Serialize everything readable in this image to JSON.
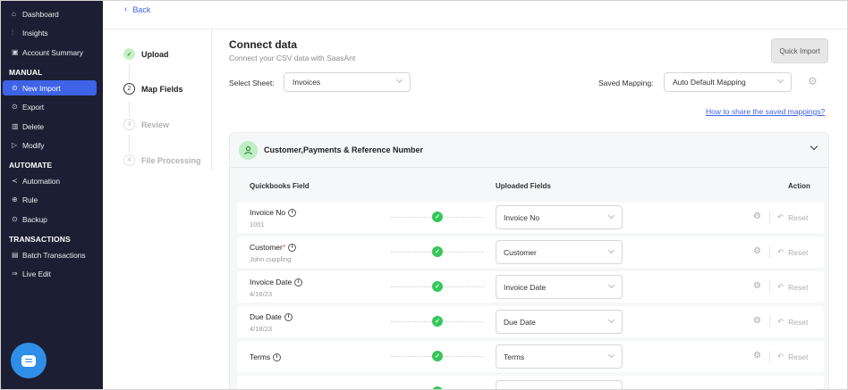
{
  "sidebar": {
    "items": [
      {
        "label": "Dashboard",
        "icon": "home-icon",
        "glyph": "⌂"
      },
      {
        "label": "Insights",
        "icon": "insights-icon",
        "glyph": "⫶"
      },
      {
        "label": "Account Summary",
        "icon": "account-summary-icon",
        "glyph": "▣"
      }
    ],
    "manual_title": "MANUAL",
    "manual_items": [
      {
        "label": "New Import",
        "icon": "import-icon",
        "glyph": "⊙",
        "active": true
      },
      {
        "label": "Export",
        "icon": "export-icon",
        "glyph": "⊙"
      },
      {
        "label": "Delete",
        "icon": "delete-icon",
        "glyph": "▥"
      },
      {
        "label": "Modify",
        "icon": "modify-icon",
        "glyph": "▷"
      }
    ],
    "automate_title": "AUTOMATE",
    "automate_items": [
      {
        "label": "Automation",
        "icon": "automation-icon",
        "glyph": "≺"
      },
      {
        "label": "Rule",
        "icon": "rule-icon",
        "glyph": "⊕"
      },
      {
        "label": "Backup",
        "icon": "backup-icon",
        "glyph": "⊙"
      }
    ],
    "transactions_title": "TRANSACTIONS",
    "transactions_items": [
      {
        "label": "Batch Transactions",
        "icon": "batch-icon",
        "glyph": "▤"
      },
      {
        "label": "Live Edit",
        "icon": "live-edit-icon",
        "glyph": "⇒"
      }
    ]
  },
  "back": {
    "label": "Back"
  },
  "steps": [
    {
      "num": "✓",
      "label": "Upload",
      "state": "done"
    },
    {
      "num": "2",
      "label": "Map Fields",
      "state": "current"
    },
    {
      "num": "3",
      "label": "Review",
      "state": "pending"
    },
    {
      "num": "4",
      "label": "File Processing",
      "state": "pending"
    }
  ],
  "header": {
    "title": "Connect data",
    "subtitle": "Connect your CSV data with SaasAnt",
    "quick_import": "Quick Import"
  },
  "sheet": {
    "label": "Select Sheet:",
    "value": "Invoices"
  },
  "mapping": {
    "label": "Saved Mapping:",
    "value": "Auto Default Mapping"
  },
  "share_link": "How to share the saved mappings?",
  "panel": {
    "title": "Customer,Payments & Reference Number",
    "col_quickbooks": "Quickbooks Field",
    "col_uploaded": "Uploaded Fields",
    "col_action": "Action",
    "reset_label": "Reset",
    "rows": [
      {
        "field": "Invoice No",
        "required": false,
        "sample": "1001",
        "uploaded": "Invoice No"
      },
      {
        "field": "Customer",
        "required": true,
        "sample": "John cuppling",
        "uploaded": "Customer"
      },
      {
        "field": "Invoice Date",
        "required": false,
        "sample": "4/18/23",
        "uploaded": "Invoice Date"
      },
      {
        "field": "Due Date",
        "required": false,
        "sample": "4/18/23",
        "uploaded": "Due Date"
      },
      {
        "field": "Terms",
        "required": false,
        "sample": "",
        "uploaded": "Terms"
      }
    ]
  },
  "colors": {
    "sidebar_bg": "#1c1f33",
    "accent": "#3d63e6",
    "success": "#34c759"
  }
}
